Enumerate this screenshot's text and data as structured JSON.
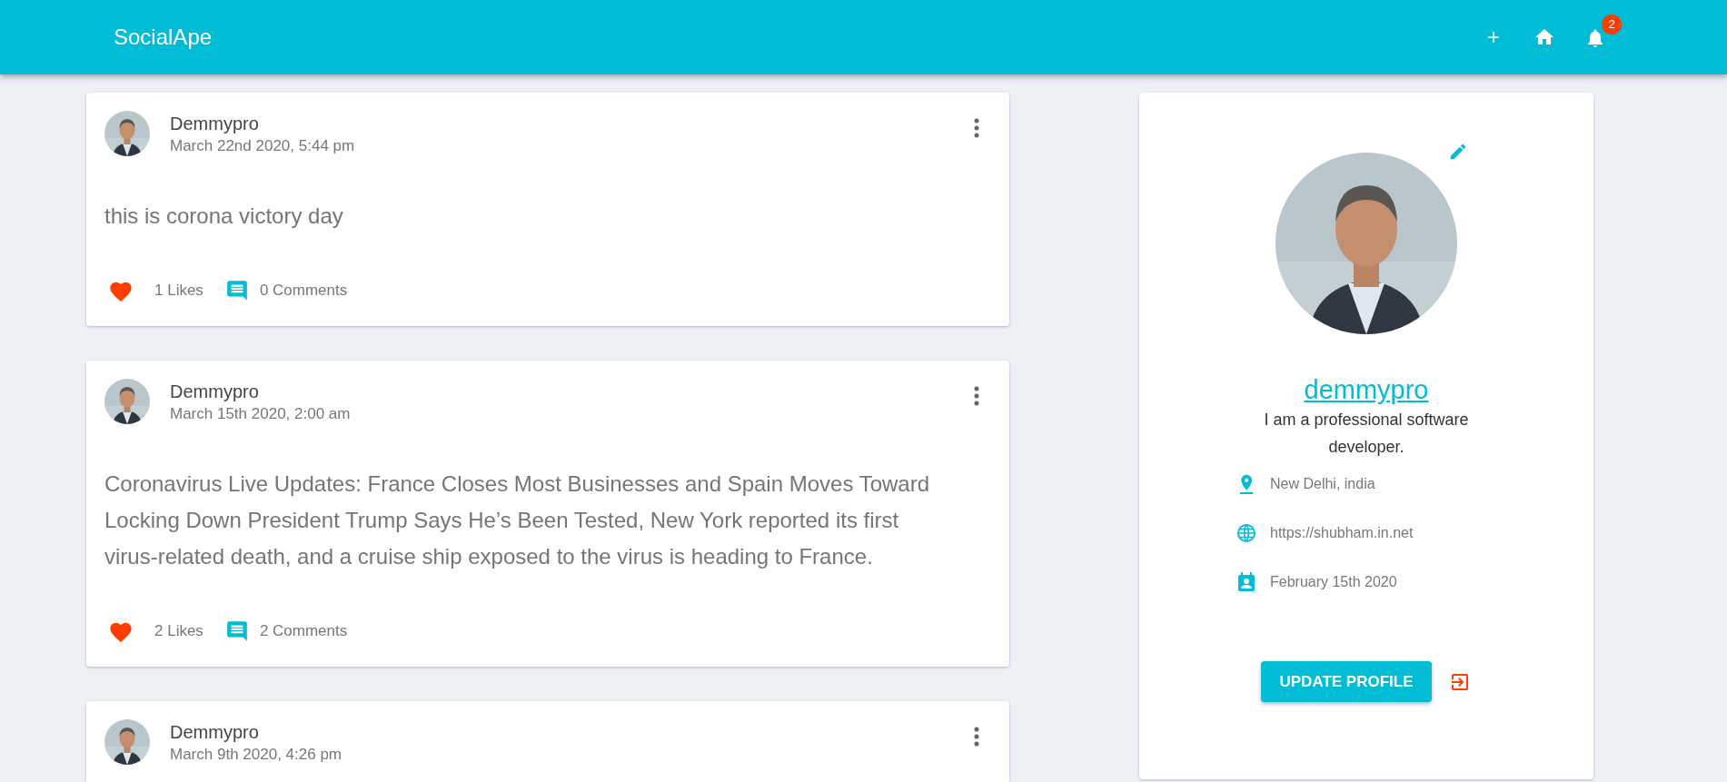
{
  "navbar": {
    "brand": "SocialApe",
    "notification_count": "2"
  },
  "posts": [
    {
      "author": "Demmypro",
      "date": "March 22nd 2020, 5:44 pm",
      "body": "this is corona victory day",
      "liked": true,
      "likes": "1 Likes",
      "comments": "0 Comments"
    },
    {
      "author": "Demmypro",
      "date": "March 15th 2020, 2:00 am",
      "body": "Coronavirus Live Updates: France Closes Most Businesses and Spain Moves Toward Locking Down President Trump Says He’s Been Tested, New York reported its first virus-related death, and a cruise ship exposed to the virus is heading to France.",
      "liked": true,
      "likes": "2 Likes",
      "comments": "2 Comments"
    },
    {
      "author": "Demmypro",
      "date": "March 9th 2020, 4:26 pm"
    }
  ],
  "profile": {
    "handle": "demmypro",
    "bio": "I am a professional software developer.",
    "details": [
      {
        "kind": "location",
        "text": "New Delhi, india"
      },
      {
        "kind": "website",
        "text": "https://shubham.in.net"
      },
      {
        "kind": "joined",
        "text": "February 15th 2020"
      }
    ],
    "button": "UPDATE PROFILE"
  }
}
